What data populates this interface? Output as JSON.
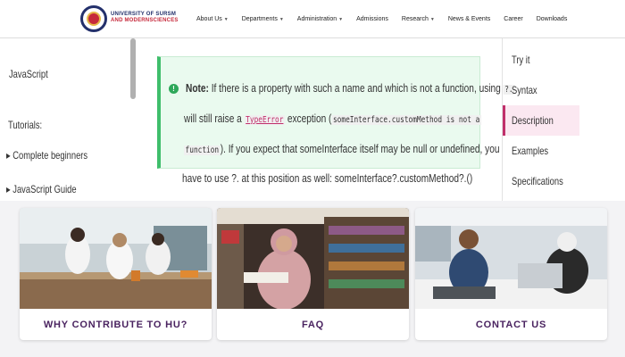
{
  "header": {
    "logo_line1": "UNIVERSITY OF SURSM",
    "logo_line2": "AND MODERNSCIENCES",
    "nav": [
      {
        "label": "About Us",
        "dropdown": true
      },
      {
        "label": "Departments",
        "dropdown": true
      },
      {
        "label": "Administration",
        "dropdown": true
      },
      {
        "label": "Admissions",
        "dropdown": false
      },
      {
        "label": "Research",
        "dropdown": true
      },
      {
        "label": "News & Events",
        "dropdown": false
      },
      {
        "label": "Career",
        "dropdown": false
      },
      {
        "label": "Downloads",
        "dropdown": false
      }
    ]
  },
  "sidebar": {
    "title": "JavaScript",
    "subtitle": "Tutorials:",
    "links": [
      "Complete beginners",
      "JavaScript Guide"
    ]
  },
  "note": {
    "icon": "!",
    "prefix": "Note:",
    "line1_text": " If there is a property with such a name and which is not a function, using ",
    "line1_code": "?.",
    "line2_text_a": "will still raise a ",
    "line2_code": "TypeError",
    "line2_text_b": " exception (",
    "line2_code2": "someInterface.customMethod is not a",
    "line3_code": "function",
    "line3_text": "). If you expect that someInterface itself may be null or undefined, you",
    "after": "have to use ?. at this position as well: someInterface?.customMethod?.()"
  },
  "toc": {
    "items": [
      "Try it",
      "Syntax",
      "Description",
      "Examples",
      "Specifications"
    ],
    "active": "Description"
  },
  "cards": [
    {
      "label": "WHY CONTRIBUTE TO HU?"
    },
    {
      "label": "FAQ"
    },
    {
      "label": "CONTACT US"
    }
  ],
  "colors": {
    "brand": "#23306b",
    "accent": "#c0306b",
    "note_border": "#3fbe6b",
    "card_label": "#4a2360"
  }
}
